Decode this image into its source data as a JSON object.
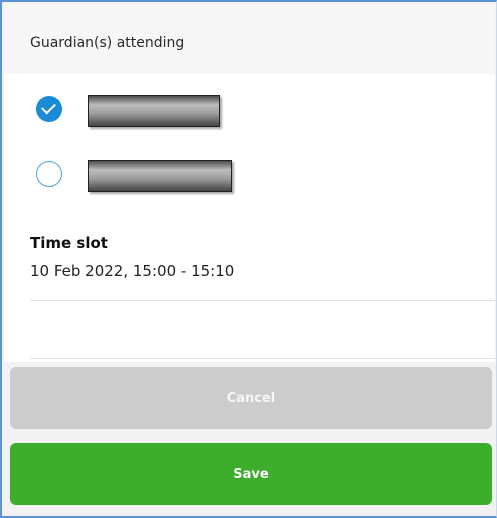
{
  "header": {
    "title": "Guardian(s) attending"
  },
  "guardians": [
    {
      "checked": true,
      "name_redacted": true
    },
    {
      "checked": false,
      "name_redacted": true
    }
  ],
  "timeslot": {
    "label": "Time slot",
    "value": "10 Feb 2022, 15:00 - 15:10"
  },
  "buttons": {
    "cancel_label": "Cancel",
    "save_label": "Save"
  },
  "colors": {
    "accent": "#1a8bd6",
    "save": "#3dae2b",
    "cancel": "#cccccc"
  }
}
